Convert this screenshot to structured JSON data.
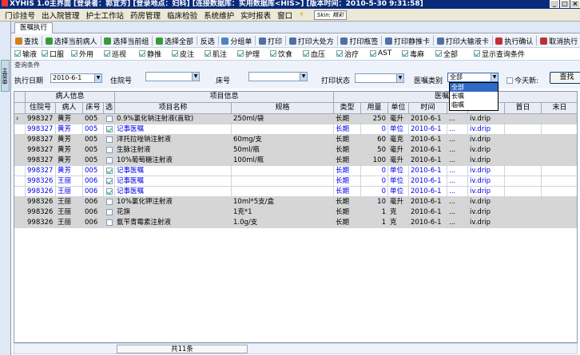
{
  "window": {
    "title": "XYHIS 1.0主界面 [登录者：郭宜芳] [登录地点：妇科] [连接数据库：实用数据库<HIS>] [版本时间：2010-5-30 9:31:58]"
  },
  "menu": [
    "门诊挂号",
    "出入院管理",
    "护士工作站",
    "药房管理",
    "临床检验",
    "系统维护",
    "实时报表",
    "窗口"
  ],
  "skin": "Skin: 精彩",
  "left_tab": "主菜单",
  "doc_tab": "医嘱执行",
  "toolbar": [
    {
      "label": "查找",
      "icon": "search-icon",
      "color": "#d08020"
    },
    {
      "label": "选择当前病人",
      "icon": "add-icon",
      "color": "#3a9a3a"
    },
    {
      "label": "选择当前组",
      "icon": "add-icon",
      "color": "#3a9a3a"
    },
    {
      "label": "选择全部",
      "icon": "add-icon",
      "color": "#3a9a3a"
    },
    {
      "label": "反选",
      "icon": "",
      "color": ""
    },
    {
      "label": "分组单",
      "icon": "group-icon",
      "color": "#5080c0"
    },
    {
      "label": "打印",
      "icon": "print-icon",
      "color": "#5070a0"
    },
    {
      "label": "打印大处方",
      "icon": "print-icon",
      "color": "#5070a0"
    },
    {
      "label": "打印瓶签",
      "icon": "print-icon",
      "color": "#5070a0"
    },
    {
      "label": "打印静推卡",
      "icon": "print-icon",
      "color": "#5070a0"
    },
    {
      "label": "打印大输液卡",
      "icon": "print-icon",
      "color": "#5070a0"
    },
    {
      "label": "执行确认",
      "icon": "confirm-icon",
      "color": "#c03030"
    },
    {
      "label": "取消执行",
      "icon": "cancel-icon",
      "color": "#c03030"
    }
  ],
  "filters": [
    {
      "label": "输液",
      "checked": true
    },
    {
      "label": "口服",
      "checked": true
    },
    {
      "label": "外用",
      "checked": true
    },
    {
      "label": "巡视",
      "checked": true
    },
    {
      "label": "静推",
      "checked": true
    },
    {
      "label": "皮注",
      "checked": true
    },
    {
      "label": "肌注",
      "checked": true
    },
    {
      "label": "护理",
      "checked": true
    },
    {
      "label": "饮食",
      "checked": true
    },
    {
      "label": "血压",
      "checked": true
    },
    {
      "label": "治疗",
      "checked": true
    },
    {
      "label": "AST",
      "checked": true
    },
    {
      "label": "毒麻",
      "checked": true
    },
    {
      "label": "全部",
      "checked": true
    },
    {
      "label": "显示查询条件",
      "checked": true
    }
  ],
  "query": {
    "title": "查询条件",
    "date_label": "执行日期",
    "date_value": "2010-6-1",
    "hosp_label": "住院号",
    "hosp_value": "",
    "bed_label": "床号",
    "bed_value": "",
    "print_label": "打印状态",
    "print_value": "",
    "type_label": "医嘱类别",
    "type_value": "全部",
    "today_label": "今天新:",
    "search_button": "查找",
    "type_options": [
      "全部",
      "长嘱",
      "临嘱"
    ]
  },
  "grid": {
    "groups": {
      "patient": "病人信息",
      "item": "项目信息",
      "order": "医嘱"
    },
    "columns": [
      "住院号",
      "病人",
      "床号",
      "选",
      "项目名称",
      "规格",
      "类型",
      "用量",
      "单位",
      "时间",
      "",
      "",
      "首日",
      "末日"
    ],
    "rows": [
      {
        "id": "998327",
        "name": "黄芳",
        "bed": "005",
        "sel": false,
        "item": "0.9%氯化钠注射液(直软)",
        "spec": "250ml/袋",
        "type": "长期",
        "dose": "250",
        "unit": "毫升",
        "time": "2010-6-1",
        "f1": "...",
        "f2": "iv.drip",
        "style": "gray",
        "mark": "›"
      },
      {
        "id": "998327",
        "name": "黄芳",
        "bed": "005",
        "sel": true,
        "item": "记事医嘱",
        "spec": "",
        "type": "长期",
        "dose": "0",
        "unit": "单位",
        "time": "2010-6-1",
        "f1": "...",
        "f2": "iv.drip",
        "style": "blue",
        "mark": ""
      },
      {
        "id": "998327",
        "name": "黄芳",
        "bed": "005",
        "sel": false,
        "item": "洋托拉唑钠注射液",
        "spec": "60mg/支",
        "type": "长期",
        "dose": "60",
        "unit": "毫克",
        "time": "2010-6-1",
        "f1": "...",
        "f2": "iv.drip",
        "style": "gray",
        "mark": ""
      },
      {
        "id": "998327",
        "name": "黄芳",
        "bed": "005",
        "sel": false,
        "item": "生脉注射液",
        "spec": "50ml/瓶",
        "type": "长期",
        "dose": "50",
        "unit": "毫升",
        "time": "2010-6-1",
        "f1": "...",
        "f2": "iv.drip",
        "style": "gray",
        "mark": ""
      },
      {
        "id": "998327",
        "name": "黄芳",
        "bed": "005",
        "sel": false,
        "item": "10%葡萄糖注射液",
        "spec": "100ml/瓶",
        "type": "长期",
        "dose": "100",
        "unit": "毫升",
        "time": "2010-6-1",
        "f1": "...",
        "f2": "iv.drip",
        "style": "gray",
        "mark": ""
      },
      {
        "id": "998327",
        "name": "黄芳",
        "bed": "005",
        "sel": true,
        "item": "记事医嘱",
        "spec": "",
        "type": "长期",
        "dose": "0",
        "unit": "单位",
        "time": "2010-6-1",
        "f1": "...",
        "f2": "iv.drip",
        "style": "blue",
        "mark": ""
      },
      {
        "id": "998326",
        "name": "王丽",
        "bed": "006",
        "sel": true,
        "item": "记事医嘱",
        "spec": "",
        "type": "长期",
        "dose": "0",
        "unit": "单位",
        "time": "2010-6-1",
        "f1": "...",
        "f2": "iv.drip",
        "style": "blue",
        "mark": ""
      },
      {
        "id": "998326",
        "name": "王丽",
        "bed": "006",
        "sel": true,
        "item": "记事医嘱",
        "spec": "",
        "type": "长期",
        "dose": "0",
        "unit": "单位",
        "time": "2010-6-1",
        "f1": "...",
        "f2": "iv.drip",
        "style": "blue",
        "mark": ""
      },
      {
        "id": "998326",
        "name": "王丽",
        "bed": "006",
        "sel": false,
        "item": "10%氯化钾注射液",
        "spec": "10ml*5支/盒",
        "type": "长期",
        "dose": "10",
        "unit": "毫升",
        "time": "2010-6-1",
        "f1": "...",
        "f2": "iv.drip",
        "style": "gray",
        "mark": ""
      },
      {
        "id": "998326",
        "name": "王丽",
        "bed": "006",
        "sel": false,
        "item": "花旗",
        "spec": "1克*1",
        "type": "长期",
        "dose": "1",
        "unit": "克",
        "time": "2010-6-1",
        "f1": "...",
        "f2": "iv.drip",
        "style": "gray",
        "mark": ""
      },
      {
        "id": "998326",
        "name": "王丽",
        "bed": "006",
        "sel": false,
        "item": "氨苄青霉素注射液",
        "spec": "1.0g/支",
        "type": "长期",
        "dose": "1",
        "unit": "克",
        "time": "2010-6-1",
        "f1": "...",
        "f2": "iv.drip",
        "style": "gray",
        "mark": ""
      }
    ]
  },
  "status": {
    "count": "共11条"
  },
  "colors": {
    "title_bg": "#0a2a7a",
    "row_gray": "#d6d6d6",
    "text_blue": "#0000ee",
    "highlight": "#316ac5"
  }
}
